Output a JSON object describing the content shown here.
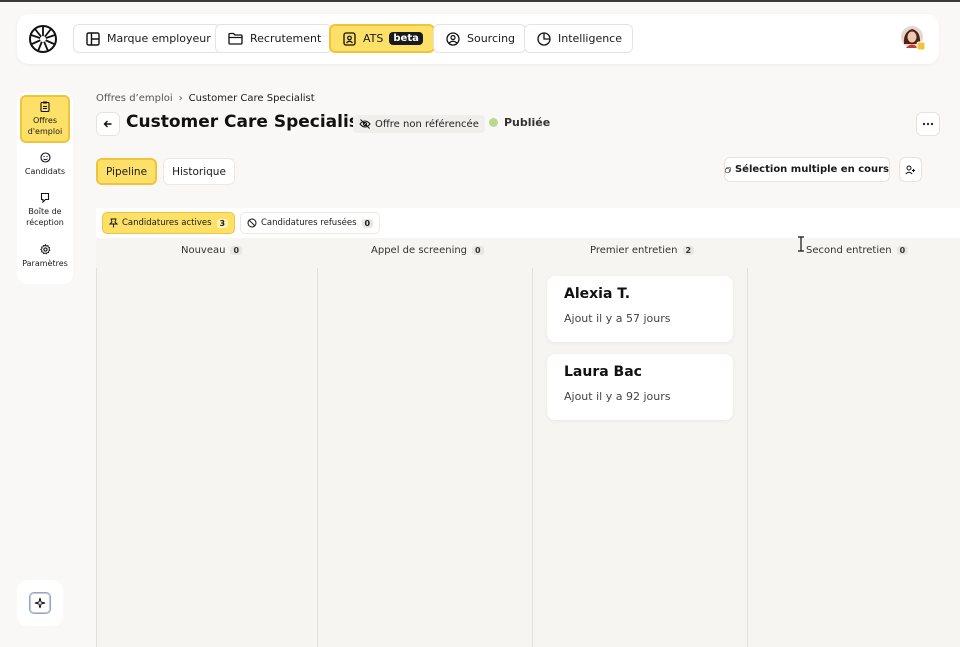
{
  "topnav": {
    "items": [
      {
        "label": "Marque employeur",
        "icon": "layout-icon"
      },
      {
        "label": "Recrutement",
        "icon": "folder-icon"
      },
      {
        "label": "ATS",
        "badge": "beta",
        "icon": "id-badge-icon",
        "active": true
      },
      {
        "label": "Sourcing",
        "icon": "user-circle-icon"
      },
      {
        "label": "Intelligence",
        "icon": "pie-chart-icon"
      }
    ]
  },
  "sidebar": {
    "items": [
      {
        "label": "Offres d'emploi",
        "icon": "clipboard-icon",
        "active": true
      },
      {
        "label": "Candidats",
        "icon": "smiley-icon"
      },
      {
        "label": "Boîte de réception",
        "icon": "inbox-icon"
      },
      {
        "label": "Paramètres",
        "icon": "gear-icon"
      }
    ]
  },
  "header": {
    "breadcrumb_parent": "Offres d’emploi",
    "breadcrumb_current": "Customer Care Specialist",
    "title": "Customer Care Specialist",
    "reference_badge": "Offre non référencée",
    "status": "Publiée"
  },
  "tabs": {
    "pipeline": "Pipeline",
    "history": "Historique"
  },
  "actions": {
    "multi_select": "Sélection multiple en cours"
  },
  "filters": {
    "active_label": "Candidatures actives",
    "active_count": "3",
    "rejected_label": "Candidatures refusées",
    "rejected_count": "0"
  },
  "columns": [
    {
      "name": "Nouveau",
      "count": "0"
    },
    {
      "name": "Appel de screening",
      "count": "0"
    },
    {
      "name": "Premier entretien",
      "count": "2"
    },
    {
      "name": "Second entretien",
      "count": "0"
    }
  ],
  "cards": [
    {
      "name": "Alexia T.",
      "added": "Ajout il y a 57 jours"
    },
    {
      "name": "Laura Bac",
      "added": "Ajout il y a 92 jours"
    }
  ],
  "colors": {
    "accent": "#fde068",
    "accent_border": "#f0c43a",
    "status_published": "#b6db8f"
  }
}
